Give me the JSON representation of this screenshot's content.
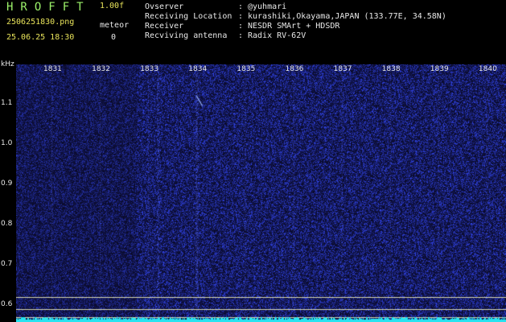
{
  "header": {
    "app_name": "HROFFT",
    "version": "1.00f",
    "file_name": "2506251830.png",
    "datetime": "25.06.25 18:30",
    "meteor_label": "meteor",
    "meteor_count": "0",
    "info": [
      {
        "label": "Ovserver",
        "sep": ":",
        "value": "@yuhmari"
      },
      {
        "label": "Receiving Location",
        "sep": ":",
        "value": "kurashiki,Okayama,JAPAN (133.77E, 34.58N)"
      },
      {
        "label": "Receiver",
        "sep": ":",
        "value": "NESDR SMArt + HDSDR"
      },
      {
        "label": "Recviving antenna",
        "sep": ":",
        "value": "Radix RV-62V"
      }
    ]
  },
  "colors": {
    "background": "#000000",
    "header_green": "#9cf26a",
    "label_yellow": "#e8e35a",
    "spectrogram_bg": "#06083a",
    "noise": "#3040ff",
    "baseline": "#27e3f0"
  },
  "spectrogram": {
    "y_unit": "kHz",
    "y_ticks": [
      {
        "label": "1.1",
        "value": 1.1
      },
      {
        "label": "1.0",
        "value": 1.0
      },
      {
        "label": "0.9",
        "value": 0.9
      },
      {
        "label": "0.8",
        "value": 0.8
      },
      {
        "label": "0.7",
        "value": 0.7
      },
      {
        "label": "0.6",
        "value": 0.6
      }
    ],
    "x_ticks": [
      "1831",
      "1832",
      "1833",
      "1834",
      "1835",
      "1836",
      "1837",
      "1838",
      "1839",
      "1840"
    ],
    "reference_lines_khz": [
      0.62,
      0.59
    ],
    "bright_columns_minute": [
      1833.2,
      1834.0
    ]
  }
}
